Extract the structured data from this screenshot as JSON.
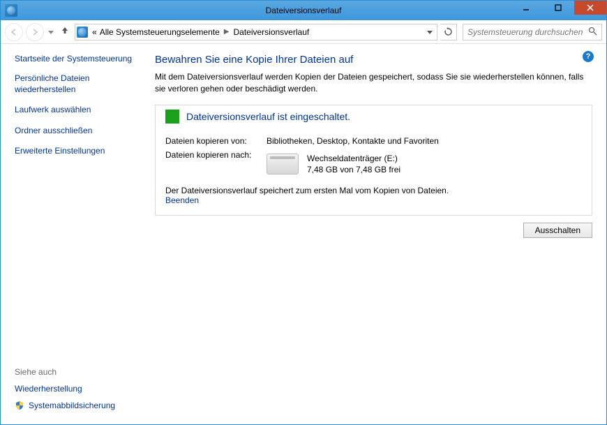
{
  "title": "Dateiversionsverlauf",
  "breadcrumbs": {
    "prefix": "«",
    "item1": "Alle Systemsteuerungselemente",
    "item2": "Dateiversionsverlauf"
  },
  "search": {
    "placeholder": "Systemsteuerung durchsuchen"
  },
  "sidebar": {
    "heading": "Startseite der Systemsteuerung",
    "links": {
      "l0": "Persönliche Dateien wiederherstellen",
      "l1": "Laufwerk auswählen",
      "l2": "Ordner ausschließen",
      "l3": "Erweiterte Einstellungen"
    },
    "see_also": "Siehe auch",
    "footer": {
      "f0": "Wiederherstellung",
      "f1": "Systemabbildsicherung"
    }
  },
  "main": {
    "heading": "Bewahren Sie eine Kopie Ihrer Dateien auf",
    "description": "Mit dem Dateiversionsverlauf werden Kopien der Dateien gespeichert, sodass Sie sie wiederherstellen können, falls sie verloren gehen oder beschädigt werden.",
    "status": "Dateiversionsverlauf ist eingeschaltet.",
    "copy_from_label": "Dateien kopieren von:",
    "copy_from_value": "Bibliotheken, Desktop, Kontakte und Favoriten",
    "copy_to_label": "Dateien kopieren nach:",
    "drive_name": "Wechseldatenträger (E:)",
    "drive_space": "7,48 GB von 7,48 GB frei",
    "saving_msg": "Der Dateiversionsverlauf speichert zum ersten Mal vom Kopien von Dateien.",
    "stop_link": "Beenden",
    "off_button": "Ausschalten"
  }
}
